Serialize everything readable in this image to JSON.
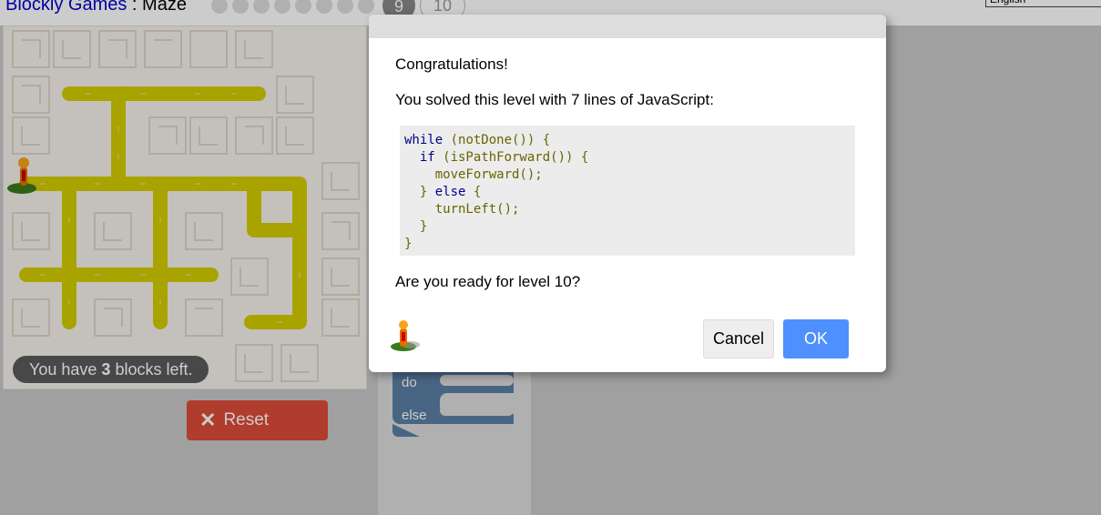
{
  "header": {
    "title_link": "Blockly Games",
    "title_rest": " : Maze",
    "current_level": "9",
    "next_level": "10",
    "language": "English"
  },
  "maze": {
    "capacity_prefix": "You have ",
    "capacity_count": "3",
    "capacity_suffix": " blocks left."
  },
  "reset": {
    "label": "Reset",
    "icon": "close-icon"
  },
  "toolbox": {
    "do_label": "do",
    "else_label": "else"
  },
  "dialog": {
    "congrats": "Congratulations!",
    "lines_message": "You solved this level with 7 lines of JavaScript:",
    "code": {
      "line1_kw": "while",
      "line1_rest": " (notDone()) {",
      "line2_kw": "if",
      "line2_rest": " (isPathForward()) {",
      "line3": "moveForward();",
      "line4_pre": "} ",
      "line4_kw": "else",
      "line4_post": " {",
      "line5": "turnLeft();",
      "line6": "}",
      "line7": "}"
    },
    "next_prompt": "Are you ready for level 10?",
    "cancel_label": "Cancel",
    "ok_label": "OK"
  },
  "colors": {
    "path": "#d4cc00",
    "reset": "#dd4b39",
    "ok": "#4d90fe",
    "block": "#5b80a5"
  }
}
